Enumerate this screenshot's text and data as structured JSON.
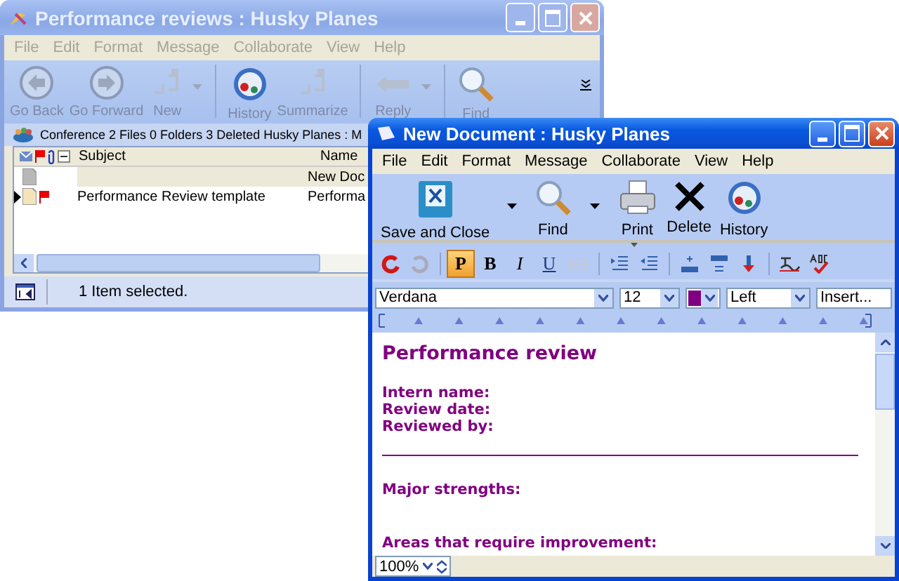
{
  "background_window": {
    "title": "Performance reviews : Husky Planes",
    "active": false,
    "menu": [
      "File",
      "Edit",
      "Format",
      "Message",
      "Collaborate",
      "View",
      "Help"
    ],
    "toolbar": [
      {
        "kind": "back",
        "label": "Go Back",
        "dropdown": false
      },
      {
        "kind": "forward",
        "label": "Go Forward",
        "dropdown": false
      },
      {
        "kind": "new",
        "label": "New",
        "dropdown": true
      },
      {
        "kind": "history",
        "label": "History",
        "dropdown": false
      },
      {
        "kind": "summarize",
        "label": "Summarize",
        "dropdown": false
      },
      {
        "kind": "reply",
        "label": "Reply",
        "dropdown": true
      },
      {
        "kind": "find",
        "label": "Find",
        "dropdown": false
      }
    ],
    "info_bar": [
      "Conference",
      "2 Files",
      "0 Folders",
      "3 Deleted",
      "Husky Planes : M"
    ],
    "list": {
      "columns": [
        "Subject",
        "Name"
      ],
      "rows": [
        {
          "subject": "",
          "name": "New Doc",
          "selected": true,
          "current": false,
          "flagged": false
        },
        {
          "subject": "Performance Review template",
          "name": "Performa",
          "selected": false,
          "current": true,
          "flagged": true
        }
      ]
    },
    "status_bar": "1 Item selected."
  },
  "document_window": {
    "title": "New Document : Husky Planes",
    "active": true,
    "menu": [
      "File",
      "Edit",
      "Format",
      "Message",
      "Collaborate",
      "View",
      "Help"
    ],
    "toolbar": [
      {
        "kind": "save",
        "label": "Save and Close",
        "dropdown": true
      },
      {
        "kind": "find",
        "label": "Find",
        "dropdown": true
      },
      {
        "kind": "print",
        "label": "Print",
        "dropdown": false
      },
      {
        "kind": "delete",
        "label": "Delete",
        "dropdown": false
      },
      {
        "kind": "history",
        "label": "History",
        "dropdown": false
      }
    ],
    "format_bar": [
      {
        "kind": "undo"
      },
      {
        "kind": "redo"
      },
      {
        "kind": "sep"
      },
      {
        "kind": "style",
        "label": "P",
        "selected": true
      },
      {
        "kind": "style",
        "label": "B",
        "selected": false
      },
      {
        "kind": "style",
        "label": "I",
        "selected": false
      },
      {
        "kind": "style",
        "label": "U",
        "selected": false
      },
      {
        "kind": "strike"
      },
      {
        "kind": "sep"
      },
      {
        "kind": "indent"
      },
      {
        "kind": "outdent"
      },
      {
        "kind": "sep"
      },
      {
        "kind": "row-above"
      },
      {
        "kind": "row-below"
      },
      {
        "kind": "down"
      },
      {
        "kind": "sep"
      },
      {
        "kind": "signature"
      },
      {
        "kind": "spell"
      }
    ],
    "font": "Verdana",
    "size": "12",
    "color": "#800080",
    "align": "Left",
    "insert": "Insert...",
    "document": [
      {
        "kind": "heading",
        "text": "Performance review"
      },
      {
        "kind": "field",
        "text": "Intern name:"
      },
      {
        "kind": "field",
        "text": "Review date:"
      },
      {
        "kind": "field",
        "text": "Reviewed by:"
      },
      {
        "kind": "rule"
      },
      {
        "kind": "section",
        "text": "Major strengths:"
      },
      {
        "kind": "section",
        "text": "Areas that require improvement:"
      }
    ],
    "zoom": "100%"
  }
}
